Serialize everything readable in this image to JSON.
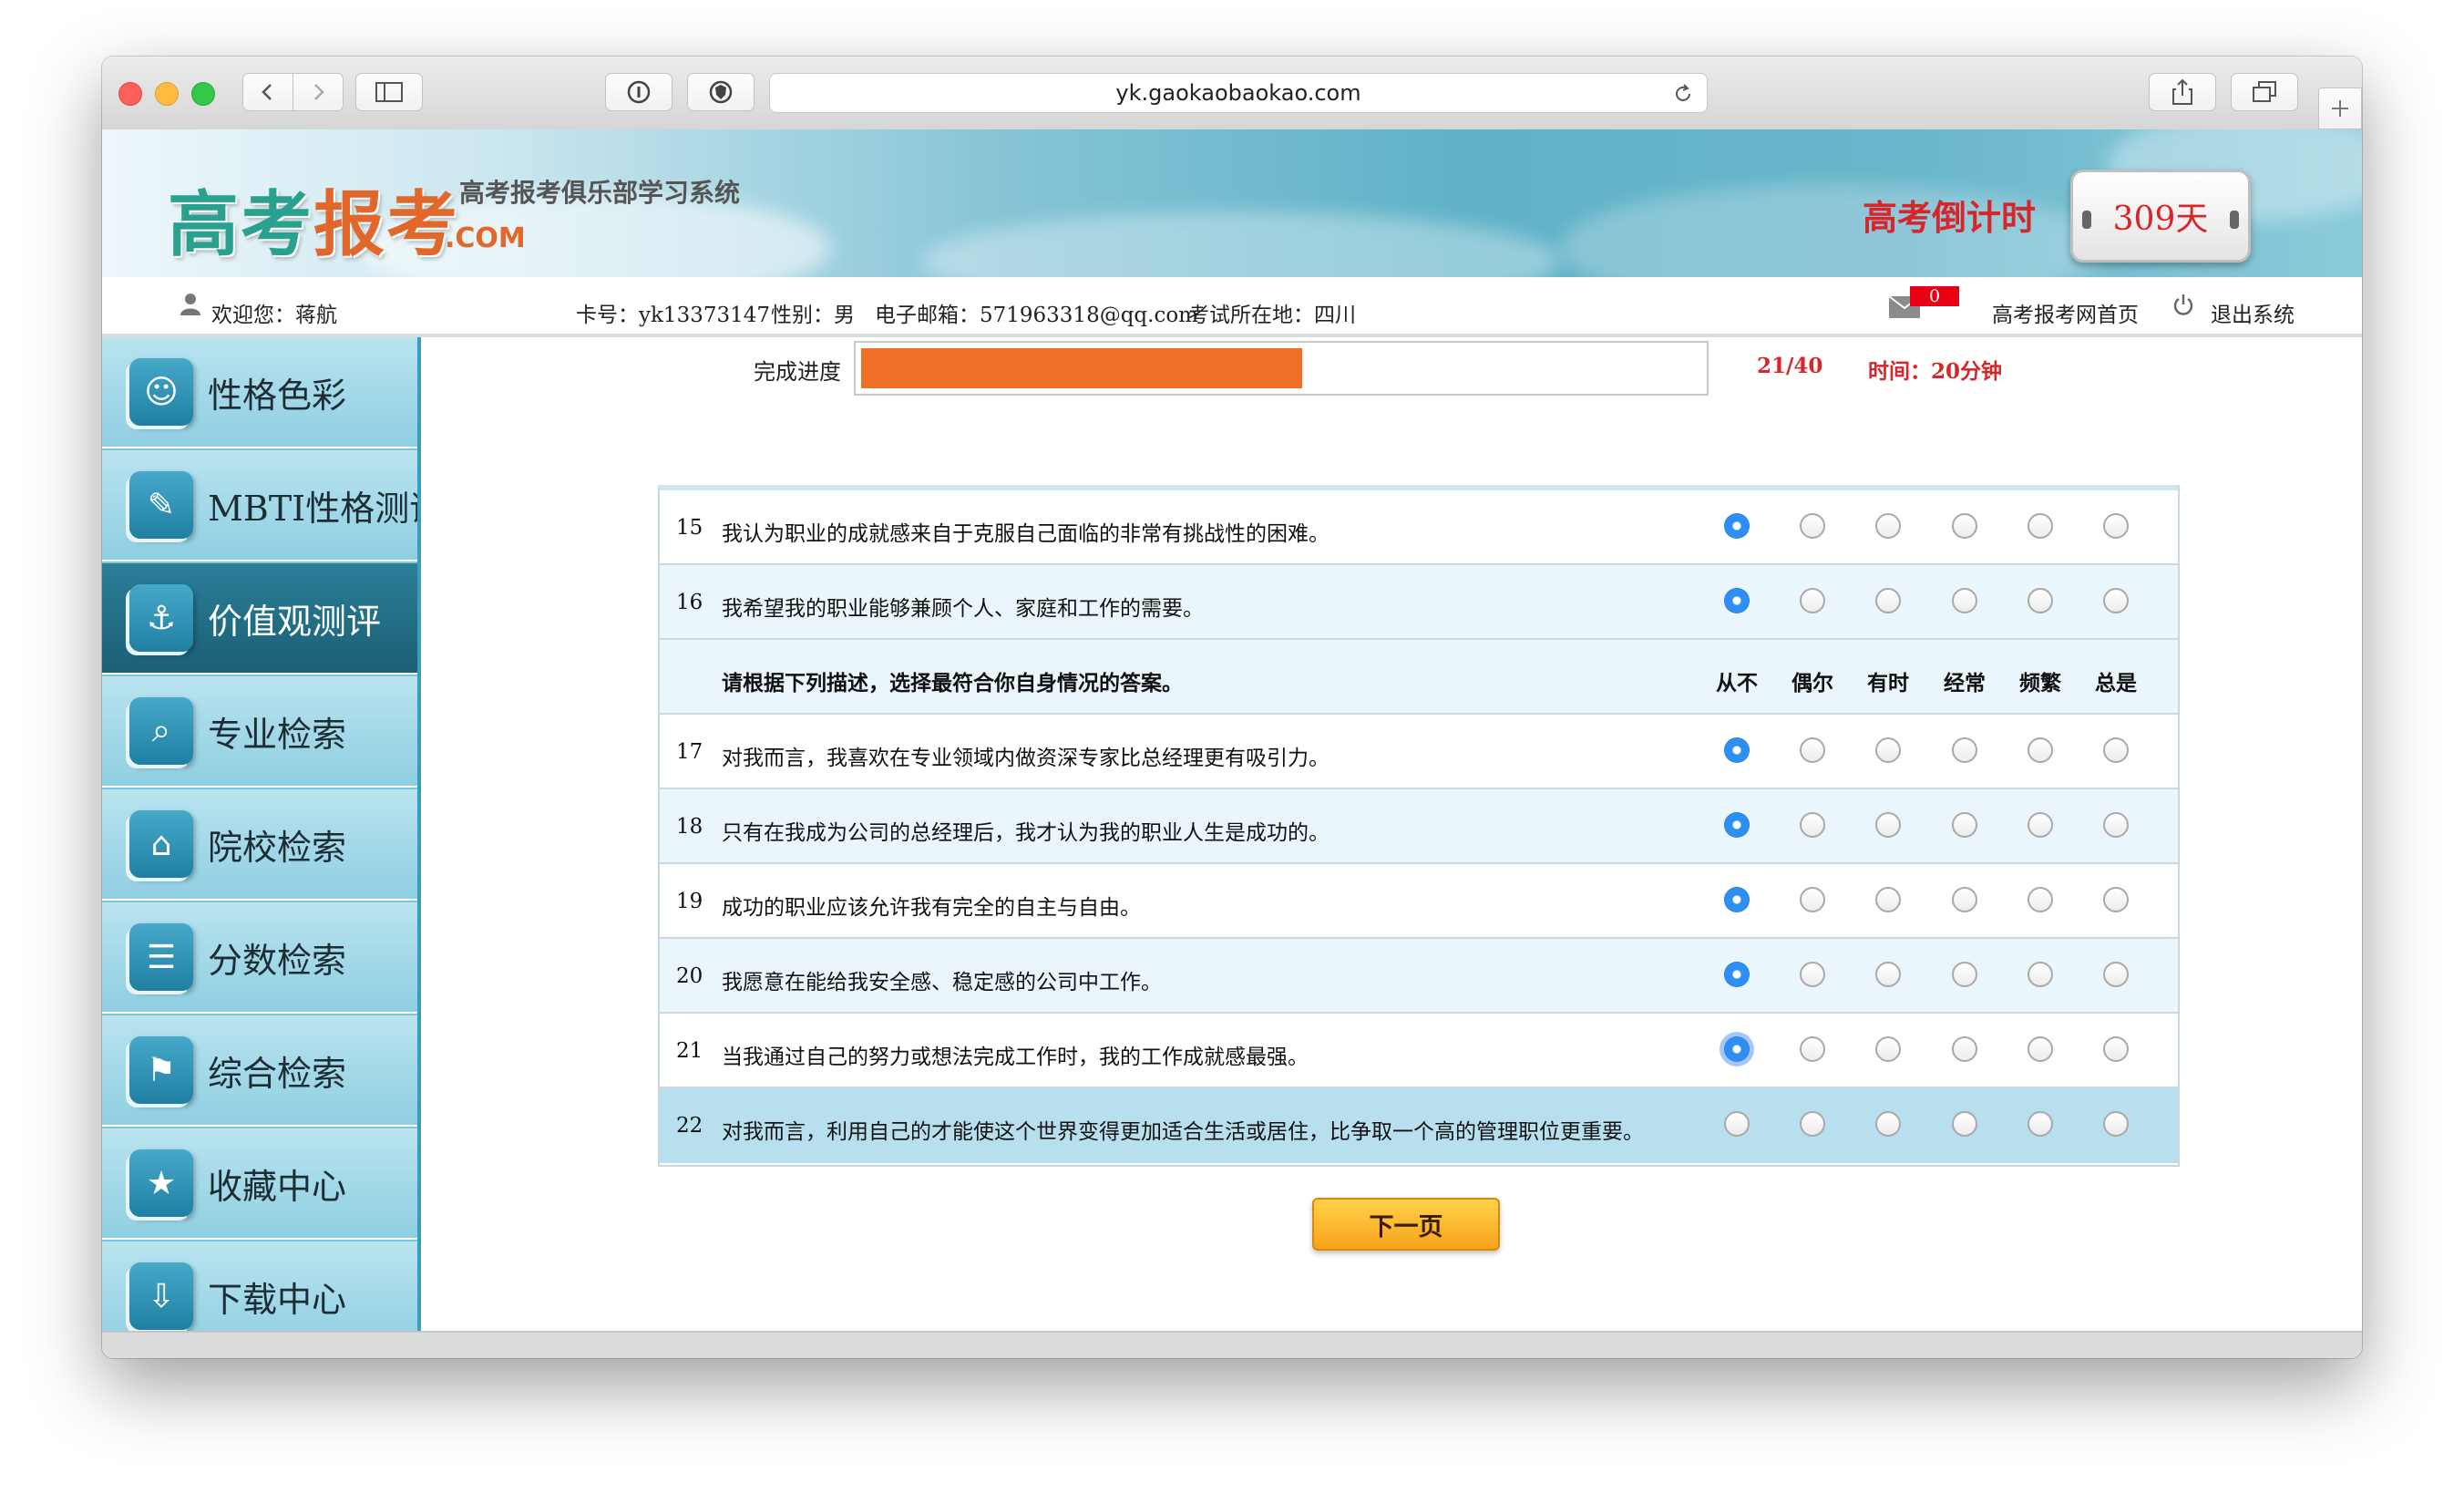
{
  "browser": {
    "url": "yk.gaokaobaokao.com",
    "back_icon": "chevron-left",
    "forward_icon": "chevron-right",
    "sidebar_icon": "sidebar-toggle",
    "reader_icon": "info-circle",
    "shield_icon": "shield",
    "reload_icon": "reload",
    "share_icon": "share",
    "tabs_icon": "tabs-overview",
    "new_tab_icon": "plus"
  },
  "header": {
    "logo_text_a": "高考",
    "logo_text_b": "报考",
    "logo_domain": ".COM",
    "site_subtitle": "高考报考俱乐部学习系统",
    "countdown_label": "高考倒计时",
    "countdown_value": "309天"
  },
  "userbar": {
    "welcome": "欢迎您：蒋航",
    "card_no": "卡号：yk13373147",
    "gender": "性别：男",
    "email": "电子邮箱：571963318@qq.com",
    "location": "考试所在地：四川",
    "mail_count": "0",
    "home_link": "高考报考网首页",
    "logout_link": "退出系统"
  },
  "sidebar": {
    "items": [
      {
        "label": "性格色彩",
        "icon": "☺",
        "active": false
      },
      {
        "label": "MBTI性格测评",
        "icon": "✎",
        "active": false
      },
      {
        "label": "价值观测评",
        "icon": "⚓",
        "active": true
      },
      {
        "label": "专业检索",
        "icon": "⌕",
        "active": false
      },
      {
        "label": "院校检索",
        "icon": "⌂",
        "active": false
      },
      {
        "label": "分数检索",
        "icon": "☰",
        "active": false
      },
      {
        "label": "综合检索",
        "icon": "⚑",
        "active": false
      },
      {
        "label": "收藏中心",
        "icon": "★",
        "active": false
      },
      {
        "label": "下载中心",
        "icon": "⇩",
        "active": false
      }
    ]
  },
  "progress": {
    "label": "完成进度",
    "fraction": 0.525,
    "count": "21/40",
    "time": "时间：20分钟"
  },
  "questionnaire": {
    "scale": [
      "从不",
      "偶尔",
      "有时",
      "经常",
      "频繁",
      "总是"
    ],
    "instruction": "请根据下列描述，选择最符合你自身情况的答案。",
    "questions": [
      {
        "num": "15",
        "text": "我认为职业的成就感来自于克服自己面临的非常有挑战性的困难。",
        "selected": 0
      },
      {
        "num": "16",
        "text": "我希望我的职业能够兼顾个人、家庭和工作的需要。",
        "selected": 0
      },
      {
        "num": "17",
        "text": "对我而言，我喜欢在专业领域内做资深专家比总经理更有吸引力。",
        "selected": 0
      },
      {
        "num": "18",
        "text": "只有在我成为公司的总经理后，我才认为我的职业人生是成功的。",
        "selected": 0
      },
      {
        "num": "19",
        "text": "成功的职业应该允许我有完全的自主与自由。",
        "selected": 0
      },
      {
        "num": "20",
        "text": "我愿意在能给我安全感、稳定感的公司中工作。",
        "selected": 0
      },
      {
        "num": "21",
        "text": "当我通过自己的努力或想法完成工作时，我的工作成就感最强。",
        "selected": 0
      },
      {
        "num": "22",
        "text": "对我而言，利用自己的才能使这个世界变得更加适合生活或居住，比争取一个高的管理职位更重要。",
        "selected": -1
      }
    ]
  },
  "actions": {
    "next_label": "下一页"
  },
  "colors": {
    "accent_orange": "#ee7026",
    "countdown_red": "#d6262a",
    "radio_blue": "#2d8ff2",
    "sidebar_active": "#1b5f75"
  }
}
